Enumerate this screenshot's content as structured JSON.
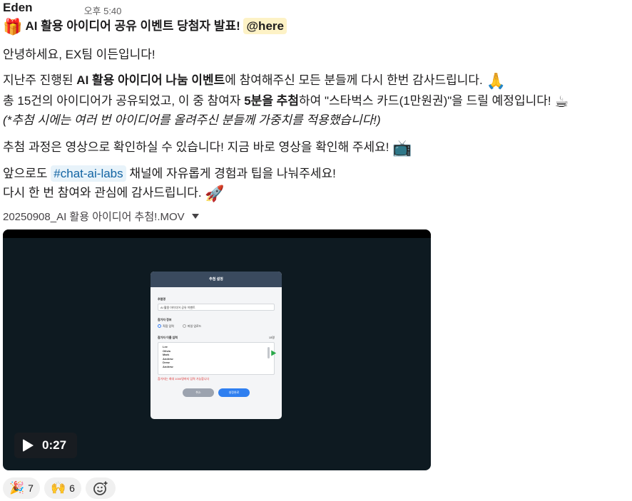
{
  "message": {
    "author": "Eden",
    "timestamp": "오후 5:40",
    "title_emoji": "🎁",
    "title": "AI 활용 아이디어 공유 이벤트 당첨자 발표!",
    "mention": "@here",
    "greeting": "안녕하세요, EX팀 이든입니다!",
    "p1_prefix": "지난주 진행된 ",
    "p1_bold": "AI 활용 아이디어 나눔 이벤트",
    "p1_suffix": "에 참여해주신 모든 분들께 다시 한번 감사드립니다.",
    "p1_emoji": "🙏",
    "p2_prefix": "총 15건의 아이디어가 공유되었고, 이 중 참여자 ",
    "p2_bold": "5분을 추첨",
    "p2_suffix": "하여 \"스타벅스 카드(1만원권)\"을 드릴 예정입니다!",
    "p2_emoji": "☕",
    "p3_italic": "(*추첨 시에는 여러 번 아이디어를 올려주신 분들께 가중치를 적용했습니다!)",
    "p4": "추첨 과정은 영상으로 확인하실 수 있습니다! 지금 바로 영상을 확인해 주세요!",
    "p4_emoji": "📺",
    "p5_prefix": "앞으로도 ",
    "channel": "#chat-ai-labs",
    "p5_suffix": " 채널에 자유롭게 경험과 팁을 나눠주세요!",
    "p6": "다시 한 번 참여와 관심에 감사드립니다.",
    "p6_emoji": "🚀"
  },
  "attachment": {
    "filename": "20250908_AI 활용 아이디어 추첨!.MOV",
    "duration": "0:27",
    "dialog": {
      "title": "추첨 설정",
      "event_label": "추첨명",
      "event_value": "AI 활용 아이디어 공유 이벤트",
      "info_label": "참가자 정보",
      "radio_on": "직접 입력",
      "radio_off": "파일 업로드",
      "names_label": "참가자 이름 입력",
      "names_count": "15명",
      "names": [
        "Lee",
        "Olivia",
        "Mark",
        "Andrew",
        "Drew",
        "Andrew"
      ],
      "warning": "참가자는 최대 1000명까지 입력 가능합니다",
      "cancel": "취소",
      "confirm": "설정완료"
    }
  },
  "reactions": [
    {
      "icon": "party-popper-icon",
      "emoji": "🎉",
      "count": "7"
    },
    {
      "icon": "raised-hands-icon",
      "emoji": "🙌",
      "count": "6"
    }
  ],
  "add_reaction_icon": "add-emoji-icon"
}
